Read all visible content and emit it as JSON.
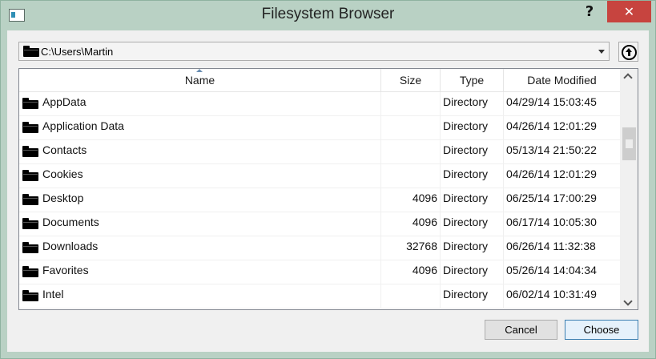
{
  "window": {
    "title": "Filesystem Browser",
    "help_label": "?",
    "close_label": "✕"
  },
  "path": {
    "value": "C:\\Users\\Martin"
  },
  "table": {
    "columns": [
      "Name",
      "Size",
      "Type",
      "Date Modified"
    ],
    "sorted_column": "Name",
    "rows": [
      {
        "name": "AppData",
        "size": "",
        "type": "Directory",
        "date": "04/29/14 15:03:45"
      },
      {
        "name": "Application Data",
        "size": "",
        "type": "Directory",
        "date": "04/26/14 12:01:29"
      },
      {
        "name": "Contacts",
        "size": "",
        "type": "Directory",
        "date": "05/13/14 21:50:22"
      },
      {
        "name": "Cookies",
        "size": "",
        "type": "Directory",
        "date": "04/26/14 12:01:29"
      },
      {
        "name": "Desktop",
        "size": "4096",
        "type": "Directory",
        "date": "06/25/14 17:00:29"
      },
      {
        "name": "Documents",
        "size": "4096",
        "type": "Directory",
        "date": "06/17/14 10:05:30"
      },
      {
        "name": "Downloads",
        "size": "32768",
        "type": "Directory",
        "date": "06/26/14 11:32:38"
      },
      {
        "name": "Favorites",
        "size": "4096",
        "type": "Directory",
        "date": "05/26/14 14:04:34"
      },
      {
        "name": "Intel",
        "size": "",
        "type": "Directory",
        "date": "06/02/14 10:31:49"
      }
    ]
  },
  "buttons": {
    "cancel": "Cancel",
    "choose": "Choose"
  },
  "icons": {
    "folder": "folder-icon",
    "up": "go-up-icon",
    "app": "app-icon"
  }
}
